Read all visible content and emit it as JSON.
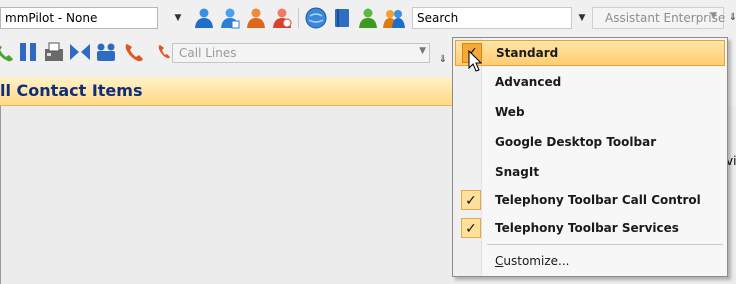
{
  "toolbar1": {
    "commpilot_value": "mmPilot - None",
    "search_value": "Search",
    "assistant_value": "Assistant Enterprise",
    "icons": [
      "person-blue-icon",
      "person-blue-2-icon",
      "person-orange-icon",
      "person-red-icon",
      "globe-icon",
      "book-icon",
      "person-green-icon",
      "people-icon"
    ]
  },
  "toolbar2": {
    "call_lines_placeholder": "Call Lines",
    "icons": [
      "phone-green-icon",
      "pause-icon",
      "fax-icon",
      "transfer-icon",
      "conference-icon",
      "phone-red-icon"
    ]
  },
  "contact": {
    "title": "ll Contact Items"
  },
  "right_sliver_text": "vi",
  "menu": {
    "items": [
      {
        "label": "Standard",
        "checked": true,
        "hot": true
      },
      {
        "label": "Advanced",
        "checked": false
      },
      {
        "label": "Web",
        "checked": false
      },
      {
        "label": "Google Desktop Toolbar",
        "checked": false
      },
      {
        "label": "SnagIt",
        "checked": false
      },
      {
        "label": "Telephony Toolbar Call Control",
        "checked": true
      },
      {
        "label": "Telephony Toolbar Services",
        "checked": true
      }
    ],
    "customize_label": "Customize..."
  },
  "colors": {
    "header_title": "#0f2d7a",
    "menu_highlight": "#ffcc70",
    "check_bg": "#ffe09a"
  }
}
